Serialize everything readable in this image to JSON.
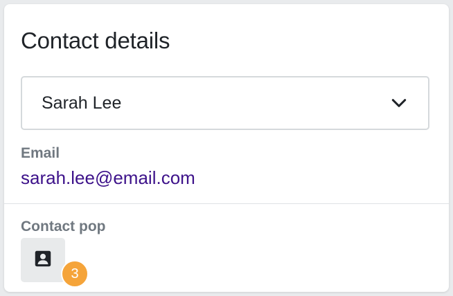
{
  "card": {
    "title": "Contact details"
  },
  "contact_select": {
    "selected_value": "Sarah Lee",
    "icon": "chevron-down-icon"
  },
  "email": {
    "label": "Email",
    "value": "sarah.lee@email.com",
    "color": "#3d128a"
  },
  "contact_pop": {
    "label": "Contact pop",
    "icon": "contact-card-icon",
    "badge_count": "3",
    "badge_color": "#f5a43a"
  }
}
